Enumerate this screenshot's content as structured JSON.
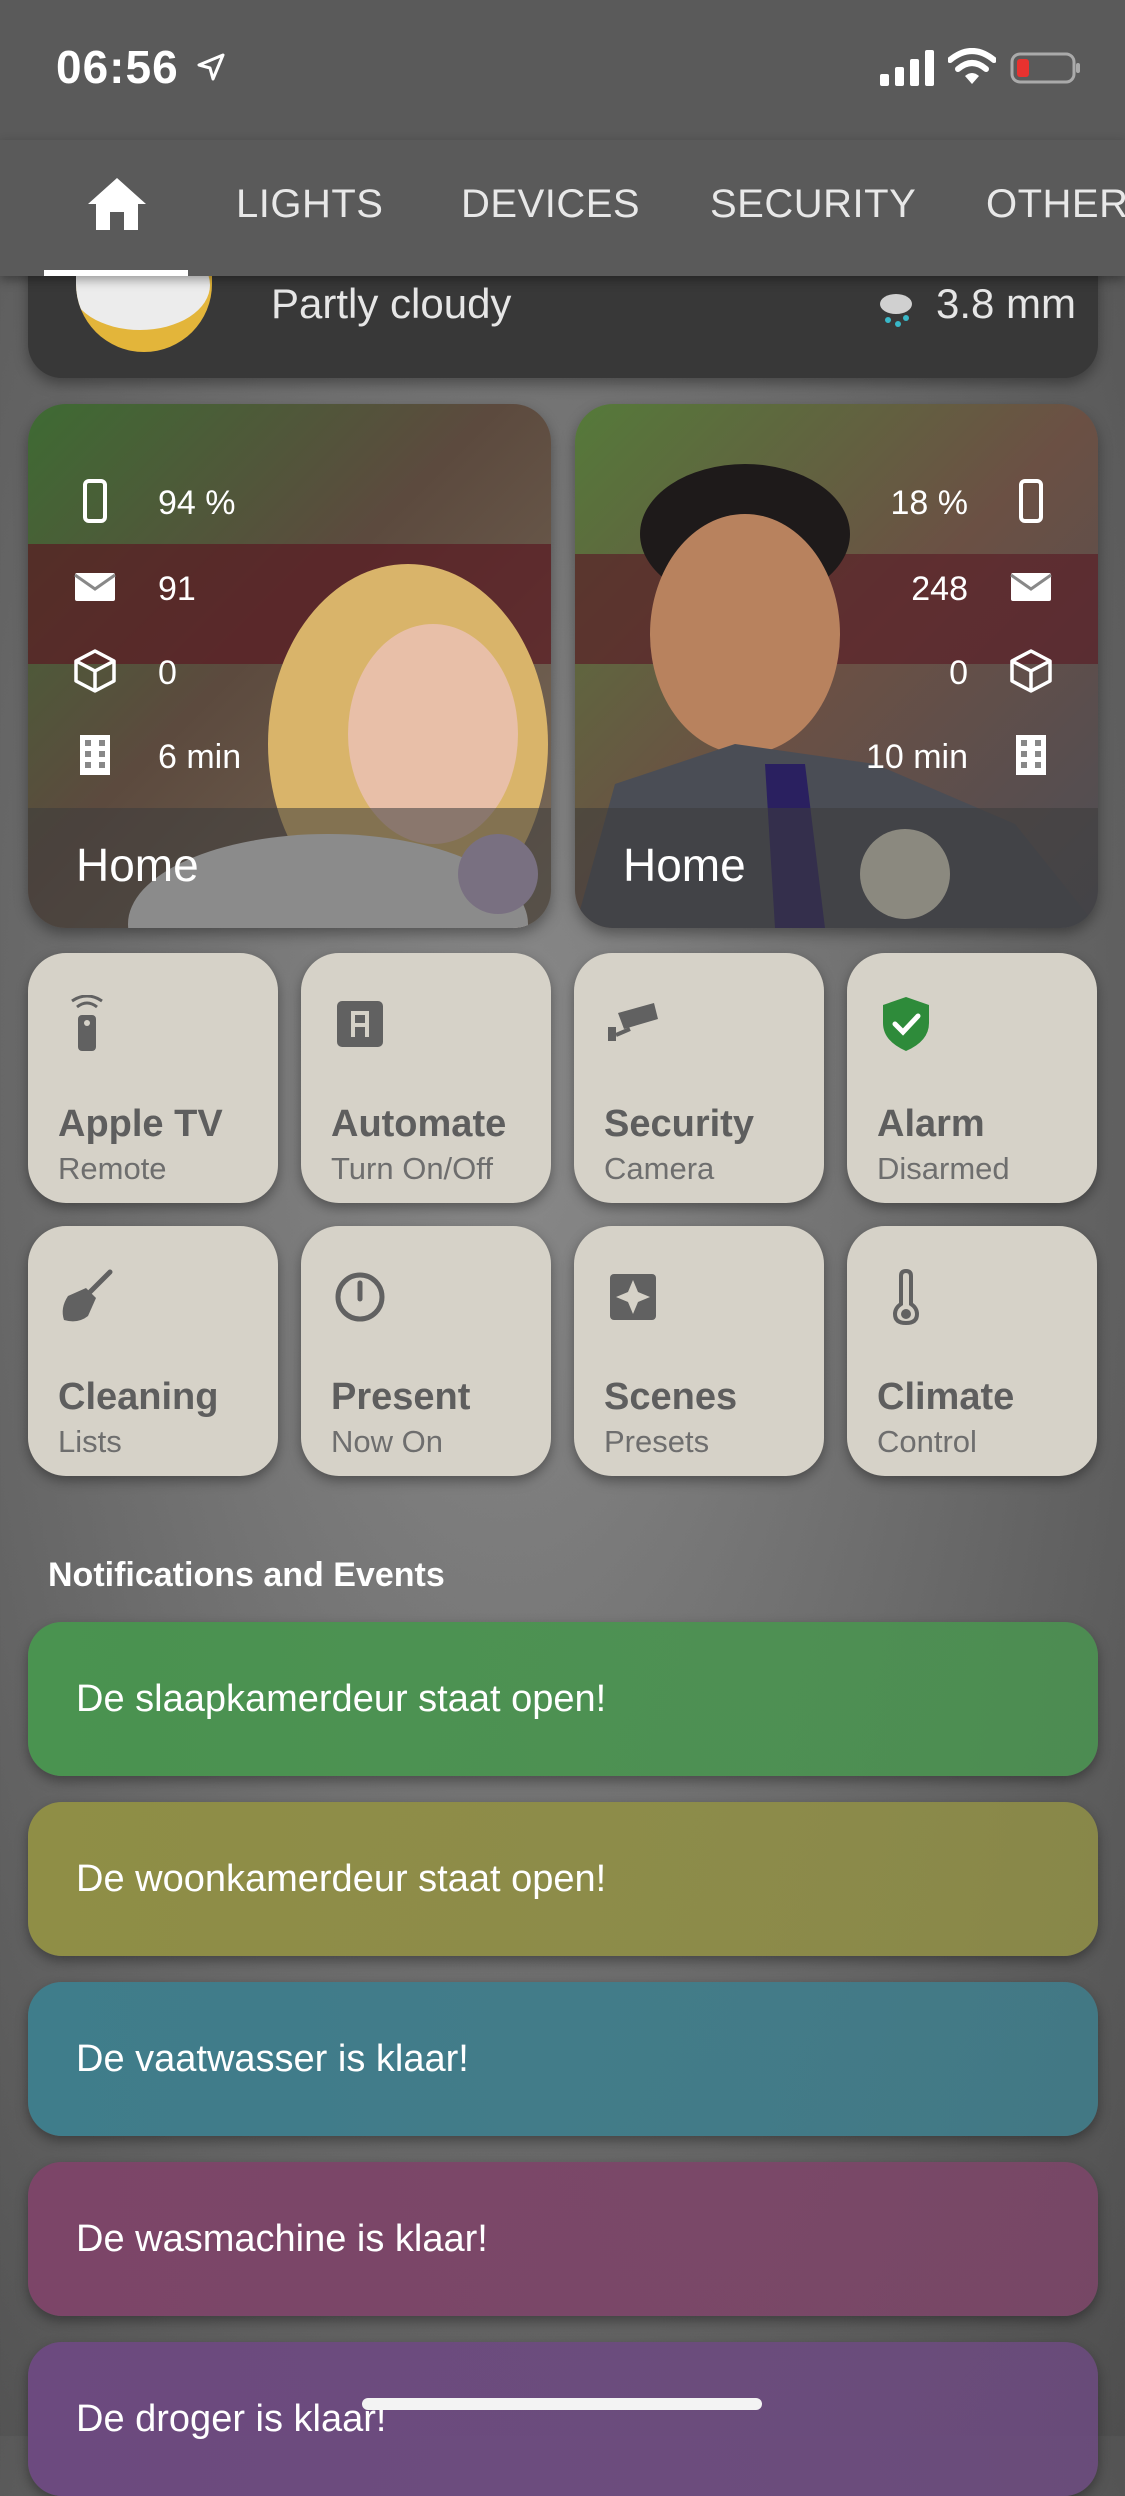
{
  "status_bar": {
    "time": "06:56"
  },
  "tabs": [
    "LIGHTS",
    "DEVICES",
    "SECURITY",
    "OTHER"
  ],
  "weather": {
    "condition": "Partly cloudy",
    "precipitation": "3.8 mm"
  },
  "persons": [
    {
      "battery": "94 %",
      "mail": "91",
      "packages": "0",
      "travel": "6 min",
      "location": "Home"
    },
    {
      "battery": "18 %",
      "mail": "248",
      "packages": "0",
      "travel": "10 min",
      "location": "Home"
    }
  ],
  "tiles": [
    {
      "title": "Apple TV",
      "subtitle": "Remote",
      "icon": "remote-icon"
    },
    {
      "title": "Automate",
      "subtitle": "Turn On/Off",
      "icon": "automation-icon"
    },
    {
      "title": "Security",
      "subtitle": "Camera",
      "icon": "cctv-icon"
    },
    {
      "title": "Alarm",
      "subtitle": "Disarmed",
      "icon": "shield-check-icon"
    },
    {
      "title": "Cleaning",
      "subtitle": "Lists",
      "icon": "broom-icon"
    },
    {
      "title": "Present",
      "subtitle": "Now On",
      "icon": "power-icon"
    },
    {
      "title": "Scenes",
      "subtitle": "Presets",
      "icon": "scene-icon"
    },
    {
      "title": "Climate",
      "subtitle": "Control",
      "icon": "thermometer-icon"
    }
  ],
  "notifications": {
    "title": "Notifications and Events",
    "items": [
      {
        "text": "De slaapkamerdeur staat open!",
        "color": "#4a9350"
      },
      {
        "text": "De woonkamerdeur staat open!",
        "color": "#8f8e46"
      },
      {
        "text": "De vaatwasser is klaar!",
        "color": "#3f7d8b"
      },
      {
        "text": "De wasmachine is klaar!",
        "color": "#7c4568"
      },
      {
        "text": "De droger is klaar!",
        "color": "#6c4a7f"
      }
    ]
  },
  "colors": {
    "header": "#5a5a5a",
    "tile": "#d6d2c8",
    "alarm_green": "#2e8b3a"
  }
}
